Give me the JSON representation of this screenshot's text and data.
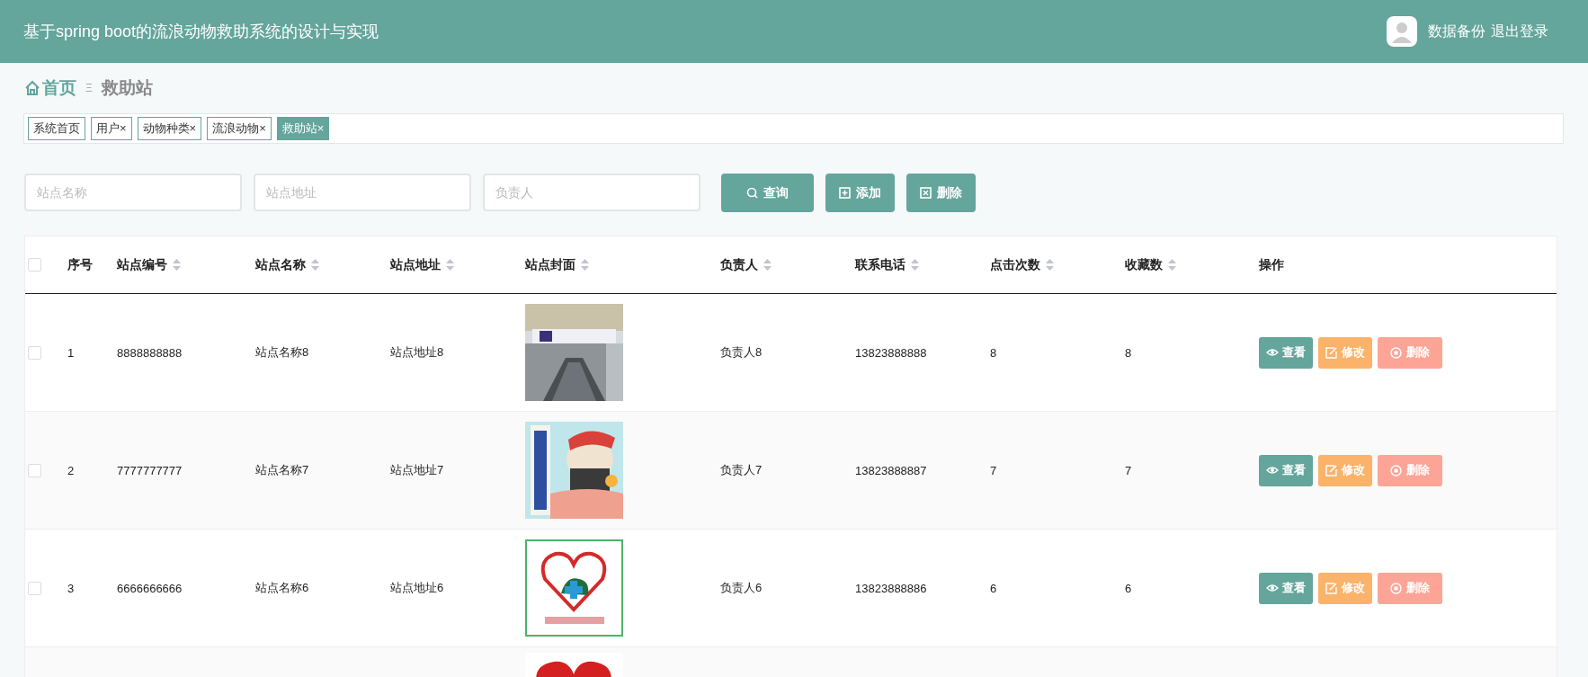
{
  "header": {
    "title": "基于spring boot的流浪动物救助系统的设计与实现",
    "links": [
      "数据备份",
      "退出登录"
    ]
  },
  "breadcrumb": {
    "home": "首页",
    "separator": "Ξ",
    "current": "救助站"
  },
  "tabs": [
    {
      "label": "系统首页",
      "selected": false
    },
    {
      "label": "用户",
      "close": "×",
      "selected": false
    },
    {
      "label": "动物种类",
      "close": "×",
      "selected": false
    },
    {
      "label": "流浪动物",
      "close": "×",
      "selected": false
    },
    {
      "label": "救助站",
      "close": "×",
      "selected": true
    }
  ],
  "search": {
    "fields": [
      {
        "placeholder": "站点名称"
      },
      {
        "placeholder": "站点地址"
      },
      {
        "placeholder": "负责人"
      }
    ],
    "buttons": [
      {
        "label": "查询",
        "kind": "search"
      },
      {
        "label": "添加",
        "kind": "add"
      },
      {
        "label": "删除",
        "kind": "delete"
      }
    ]
  },
  "table": {
    "select_all_checked": false,
    "columns": [
      {
        "label": "序号",
        "sortable": false
      },
      {
        "label": "站点编号",
        "sortable": true
      },
      {
        "label": "站点名称",
        "sortable": true
      },
      {
        "label": "站点地址",
        "sortable": true
      },
      {
        "label": "站点封面",
        "sortable": true
      },
      {
        "label": "负责人",
        "sortable": true
      },
      {
        "label": "联系电话",
        "sortable": true
      },
      {
        "label": "点击次数",
        "sortable": true
      },
      {
        "label": "收藏数",
        "sortable": true
      },
      {
        "label": "操作",
        "sortable": false
      }
    ],
    "rows": [
      {
        "checked": false,
        "cells": [
          "1",
          "8888888888",
          "站点名称8",
          "站点地址8",
          null,
          "负责人8",
          "13823888888",
          "8",
          "8"
        ],
        "cover": {
          "kind": "picture"
        },
        "actions": [
          "查看",
          "修改",
          "删除"
        ]
      },
      {
        "checked": false,
        "cells": [
          "2",
          "7777777777",
          "站点名称7",
          "站点地址7",
          null,
          "负责人7",
          "13823888887",
          "7",
          "7"
        ],
        "cover": {
          "kind": "picture"
        },
        "actions": [
          "查看",
          "修改",
          "删除"
        ]
      },
      {
        "checked": false,
        "cells": [
          "3",
          "6666666666",
          "站点名称6",
          "站点地址6",
          null,
          "负责人6",
          "13823888886",
          "6",
          "6"
        ],
        "cover": {
          "kind": "picture"
        },
        "actions": [
          "查看",
          "修改",
          "删除"
        ]
      },
      {
        "cover": {
          "kind": "picture"
        }
      }
    ]
  }
}
